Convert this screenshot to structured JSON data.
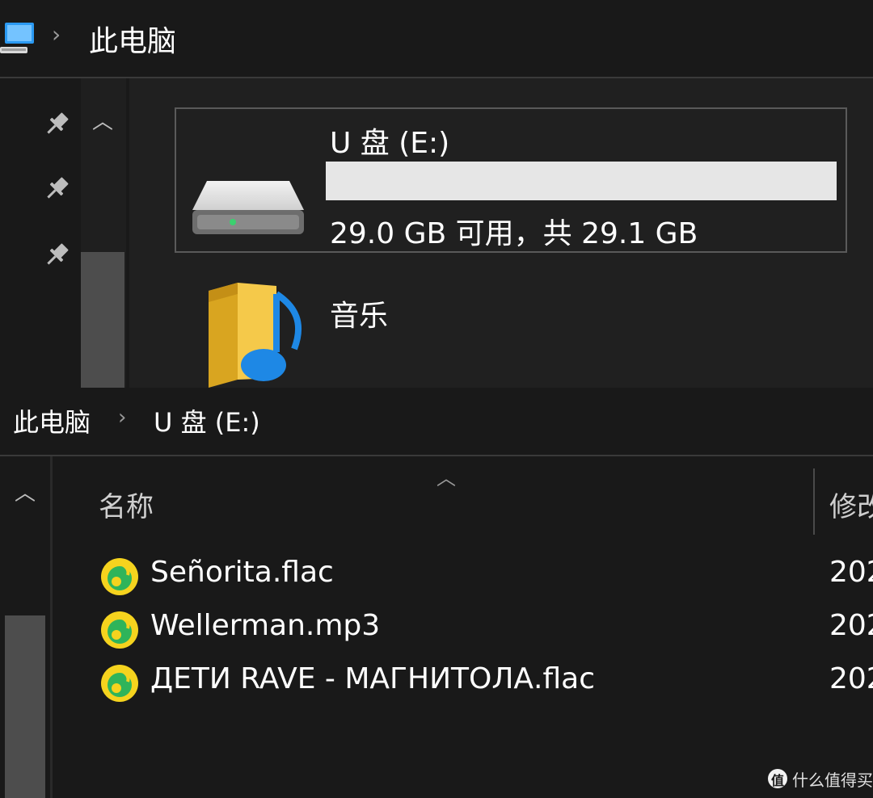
{
  "top_window": {
    "breadcrumb": {
      "separator": "›",
      "label": "此电脑"
    },
    "drive": {
      "name": "U 盘 (E:)",
      "space_text": "29.0 GB 可用，共 29.1 GB",
      "used_fraction": 1.0
    },
    "folder": {
      "name": "音乐"
    },
    "scroll_up_glyph": "︿"
  },
  "bottom_window": {
    "breadcrumb": {
      "root": "此电脑",
      "separator": "›",
      "current": "U 盘 (E:)"
    },
    "scroll_up_glyph": "︿",
    "sort_glyph": "︿",
    "columns": {
      "name": "名称",
      "modified": "修改"
    },
    "files": [
      {
        "name": "Señorita.flac",
        "date": "202"
      },
      {
        "name": "Wellerman.mp3",
        "date": "202"
      },
      {
        "name": "ДЕТИ RAVE - МАГНИТОЛА.flac",
        "date": "202"
      }
    ]
  },
  "watermark": {
    "badge": "值",
    "text": "什么值得买"
  },
  "colors": {
    "background": "#191919",
    "content_bg": "#202020",
    "bar_fill": "#e6e6e6",
    "folder_yellow": "#f4c542",
    "music_blue": "#1e88e5",
    "qq_music_yellow": "#f5d31e",
    "qq_music_green": "#2fb45a"
  }
}
